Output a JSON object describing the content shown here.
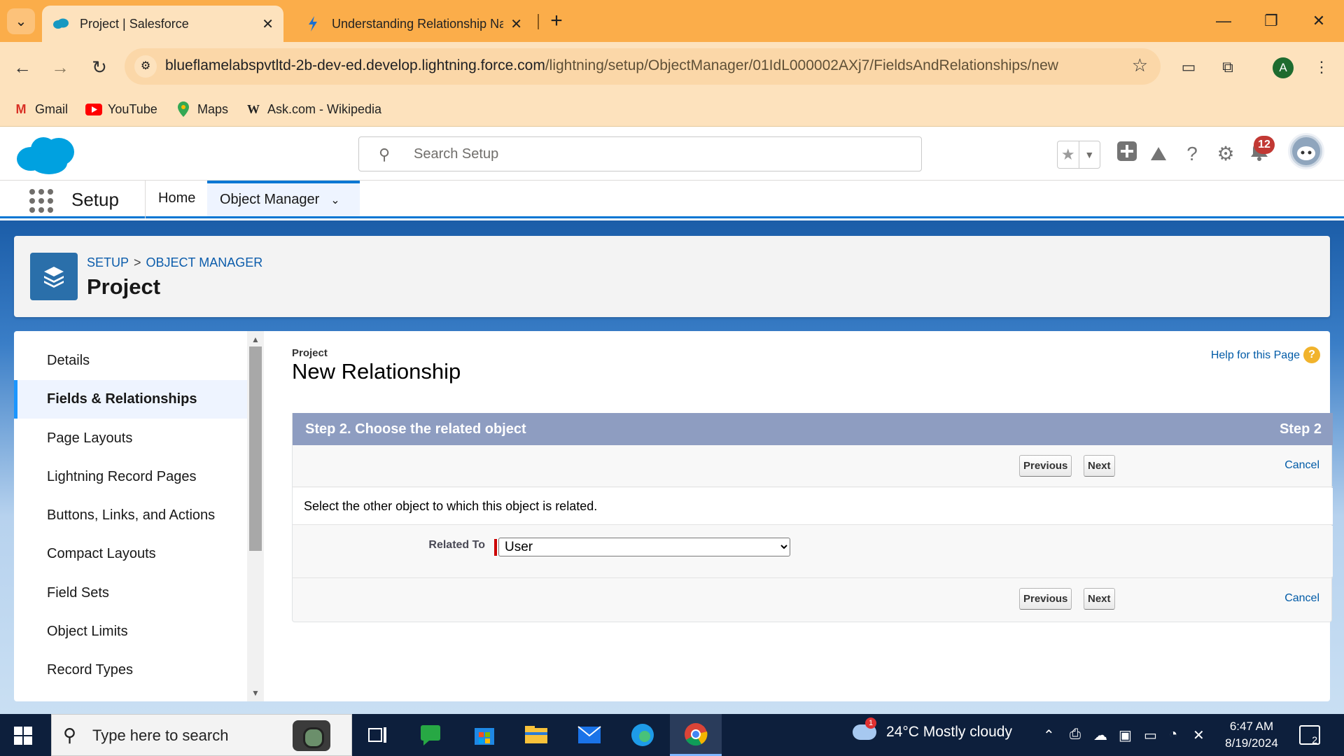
{
  "browser": {
    "tabs": [
      {
        "title": "Project | Salesforce",
        "active": true
      },
      {
        "title": "Understanding Relationship Na",
        "active": false
      }
    ],
    "url_host": "blueflamelabspvtltd-2b-dev-ed.develop.lightning.force.com",
    "url_path": "/lightning/setup/ObjectManager/01IdL000002AXj7/FieldsAndRelationships/new",
    "profile_initial": "A",
    "bookmarks": [
      "Gmail",
      "YouTube",
      "Maps",
      "Ask.com - Wikipedia"
    ]
  },
  "header": {
    "search_placeholder": "Search Setup",
    "notification_count": "12"
  },
  "nav": {
    "app_name": "Setup",
    "items": [
      "Home",
      "Object Manager"
    ]
  },
  "page_header": {
    "breadcrumb_setup": "SETUP",
    "breadcrumb_sep": ">",
    "breadcrumb_object_manager": "OBJECT MANAGER",
    "title": "Project"
  },
  "sidebar": {
    "items": [
      "Details",
      "Fields & Relationships",
      "Page Layouts",
      "Lightning Record Pages",
      "Buttons, Links, and Actions",
      "Compact Layouts",
      "Field Sets",
      "Object Limits",
      "Record Types"
    ],
    "active": "Fields & Relationships"
  },
  "content": {
    "object_label": "Project",
    "title": "New Relationship",
    "help_link": "Help for this Page",
    "step_title": "Step 2. Choose the related object",
    "step_indicator": "Step 2",
    "previous_label": "Previous",
    "next_label": "Next",
    "cancel_label": "Cancel",
    "description": "Select the other object to which this object is related.",
    "related_to_label": "Related To",
    "related_to_value": "User"
  },
  "taskbar": {
    "search_placeholder": "Type here to search",
    "weather_badge": "1",
    "weather": "24°C  Mostly cloudy",
    "time": "6:47 AM",
    "date": "8/19/2024",
    "notification_count": "2"
  },
  "colors": {
    "browser_frame": "#fbad4a",
    "salesforce_blue": "#0176d3",
    "step_header": "#8e9dc1",
    "link": "#015ba7"
  }
}
